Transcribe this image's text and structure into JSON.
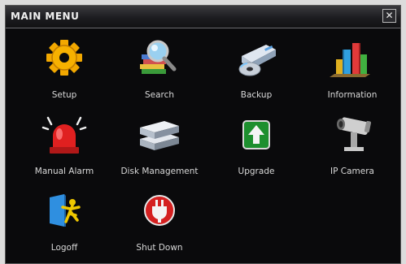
{
  "window": {
    "title": "MAIN MENU",
    "close_glyph": "✕"
  },
  "menu": {
    "items": [
      {
        "label": "Setup",
        "icon": "gear-icon"
      },
      {
        "label": "Search",
        "icon": "magnifier-icon"
      },
      {
        "label": "Backup",
        "icon": "disc-drive-icon"
      },
      {
        "label": "Information",
        "icon": "bar-chart-icon"
      },
      {
        "label": "Manual Alarm",
        "icon": "alarm-siren-icon"
      },
      {
        "label": "Disk Management",
        "icon": "hard-disk-icon"
      },
      {
        "label": "Upgrade",
        "icon": "upgrade-arrow-icon"
      },
      {
        "label": "IP Camera",
        "icon": "ip-camera-icon"
      },
      {
        "label": "Logoff",
        "icon": "logoff-door-icon"
      },
      {
        "label": "Shut Down",
        "icon": "power-plug-icon"
      }
    ]
  },
  "colors": {
    "background": "#0a0a0c",
    "label": "#d8d8d8",
    "gear": "#f2a800",
    "alarm": "#e02020",
    "upgrade": "#1d8f2e",
    "shutdown": "#d42020"
  }
}
